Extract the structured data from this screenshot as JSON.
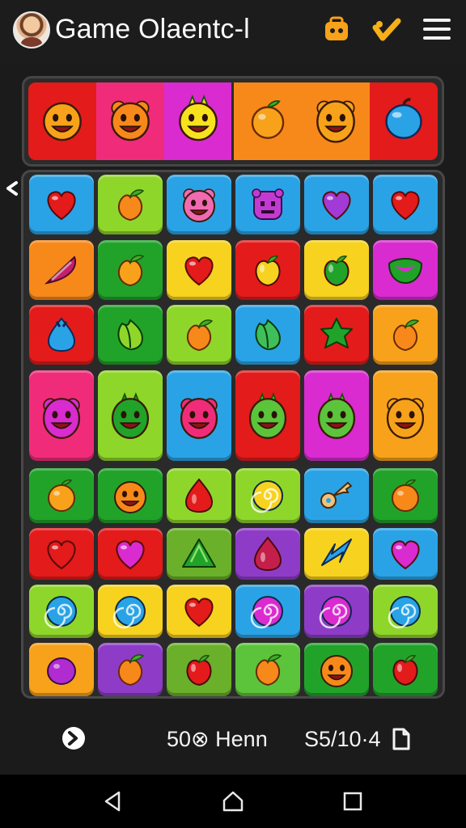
{
  "header": {
    "title": "Game Olaentc-l",
    "icons": [
      "avatar",
      "bag-icon",
      "check-icon",
      "hamburger-menu-icon"
    ]
  },
  "colors": {
    "background": "#1b1b1b",
    "red": "#e31b1b",
    "green": "#21a32a",
    "lime": "#8fd62a",
    "yellow": "#f7d21e",
    "orange": "#f7891a",
    "blue": "#2aa3e6",
    "magenta": "#d92bd0",
    "purple": "#8e3cc8",
    "pink": "#f02c7a"
  },
  "top_strip": [
    {
      "icon": "orange-smiley-icon",
      "color": "#e31b1b"
    },
    {
      "icon": "pink-cat-face-icon",
      "color": "#f02c7a"
    },
    {
      "icon": "yellow-lemon-face-icon",
      "color": "#d92bd0"
    },
    {
      "icon": "orange-fruit-icon",
      "color": "#f7891a"
    },
    {
      "icon": "orange-bear-face-icon",
      "color": "#f7891a"
    },
    {
      "icon": "blue-berry-icon",
      "color": "#e31b1b"
    }
  ],
  "board": {
    "rows": [
      [
        {
          "icon": "heart-icon",
          "fill": "#e31b1b",
          "color": "#2aa3e6"
        },
        {
          "icon": "peach-icon",
          "fill": "#f7891a",
          "color": "#8fd62a"
        },
        {
          "icon": "pig-face-icon",
          "fill": "#f06ab2",
          "color": "#2aa3e6"
        },
        {
          "icon": "monster-face-icon",
          "fill": "#c23bd1",
          "color": "#2aa3e6"
        },
        {
          "icon": "heart-icon",
          "fill": "#a13ad6",
          "color": "#2aa3e6"
        },
        {
          "icon": "heart-icon",
          "fill": "#e31b1b",
          "color": "#2aa3e6"
        }
      ],
      [
        {
          "icon": "candy-wedge-icon",
          "fill": "#c41f6a",
          "color": "#f7891a"
        },
        {
          "icon": "peach-icon",
          "fill": "#f7a21a",
          "color": "#21a32a"
        },
        {
          "icon": "heart-icon",
          "fill": "#e31b1b",
          "color": "#f7d21e"
        },
        {
          "icon": "apple-icon",
          "fill": "#f7d21e",
          "color": "#e31b1b"
        },
        {
          "icon": "apple-icon",
          "fill": "#21a32a",
          "color": "#f7d21e"
        },
        {
          "icon": "smile-mouth-icon",
          "fill": "#21a32a",
          "color": "#d92bd0"
        }
      ],
      [
        {
          "icon": "blue-drop-icon",
          "fill": "#2aa3e6",
          "color": "#e31b1b"
        },
        {
          "icon": "green-leaf-icon",
          "fill": "#8fd62a",
          "color": "#21a32a"
        },
        {
          "icon": "peach-icon",
          "fill": "#f7891a",
          "color": "#8fd62a"
        },
        {
          "icon": "green-leaf-icon",
          "fill": "#3fbf5a",
          "color": "#2aa3e6"
        },
        {
          "icon": "green-star-fruit-icon",
          "fill": "#21a32a",
          "color": "#e31b1b"
        },
        {
          "icon": "peach-icon",
          "fill": "#f7891a",
          "color": "#f7a21a"
        }
      ],
      [
        {
          "icon": "pink-bear-face-icon",
          "fill": "#d92bd0",
          "color": "#f02c7a",
          "tall": true
        },
        {
          "icon": "green-dino-face-icon",
          "fill": "#21a32a",
          "color": "#8fd62a",
          "tall": true
        },
        {
          "icon": "pink-bear-face-icon",
          "fill": "#f02c7a",
          "color": "#2aa3e6",
          "tall": true
        },
        {
          "icon": "green-monster-face-icon",
          "fill": "#5bc43a",
          "color": "#e31b1b",
          "tall": true
        },
        {
          "icon": "green-monster-face-icon",
          "fill": "#5bc43a",
          "color": "#d92bd0",
          "tall": true
        },
        {
          "icon": "orange-bear-face-icon",
          "fill": "#f7a21a",
          "color": "#f7a21a",
          "tall": true
        }
      ],
      [
        {
          "icon": "orange-fruit-icon",
          "fill": "#f7a21a",
          "color": "#21a32a"
        },
        {
          "icon": "orange-smiley-icon",
          "fill": "#f7891a",
          "color": "#21a32a"
        },
        {
          "icon": "red-drop-icon",
          "fill": "#e31b1b",
          "color": "#8fd62a"
        },
        {
          "icon": "swirl-icon",
          "fill": "#f7d21e",
          "color": "#8fd62a"
        },
        {
          "icon": "key-icon",
          "fill": "#f0c27a",
          "color": "#2aa3e6"
        },
        {
          "icon": "orange-fruit-icon",
          "fill": "#f7891a",
          "color": "#21a32a"
        }
      ],
      [
        {
          "icon": "heart-icon",
          "fill": "#e31b1b",
          "color": "#e31b1b"
        },
        {
          "icon": "heart-icon",
          "fill": "#d92bd0",
          "color": "#e31b1b"
        },
        {
          "icon": "green-triangle-icon",
          "fill": "#21a32a",
          "color": "#6ab02a"
        },
        {
          "icon": "red-drop-icon",
          "fill": "#c41f4a",
          "color": "#8e3cc8"
        },
        {
          "icon": "blue-arrow-icon",
          "fill": "#2aa3e6",
          "color": "#f7d21e"
        },
        {
          "icon": "heart-icon",
          "fill": "#d92bd0",
          "color": "#2aa3e6"
        }
      ],
      [
        {
          "icon": "swirl-icon",
          "fill": "#2aa3e6",
          "color": "#8fd62a"
        },
        {
          "icon": "swirl-icon",
          "fill": "#2aa3e6",
          "color": "#f7d21e"
        },
        {
          "icon": "heart-icon",
          "fill": "#e31b1b",
          "color": "#f7d21e"
        },
        {
          "icon": "swirl-icon",
          "fill": "#d92bd0",
          "color": "#2aa3e6"
        },
        {
          "icon": "swirl-icon",
          "fill": "#d92bd0",
          "color": "#8e3cc8"
        },
        {
          "icon": "swirl-icon",
          "fill": "#2aa3e6",
          "color": "#8fd62a"
        }
      ],
      [
        {
          "icon": "plum-icon",
          "fill": "#b02bd0",
          "color": "#f7a21a"
        },
        {
          "icon": "peach-icon",
          "fill": "#f7891a",
          "color": "#8e3cc8"
        },
        {
          "icon": "apple-icon",
          "fill": "#e31b1b",
          "color": "#6ab02a"
        },
        {
          "icon": "peach-icon",
          "fill": "#f7891a",
          "color": "#5bc43a"
        },
        {
          "icon": "orange-smiley-icon",
          "fill": "#f7891a",
          "color": "#21a32a"
        },
        {
          "icon": "apple-icon",
          "fill": "#e31b1b",
          "color": "#21a32a"
        }
      ]
    ]
  },
  "footer": {
    "score_label": "50⊗ Henn",
    "moves_label": "S5/10·4",
    "icons": [
      "next-arrow-icon",
      "copy-icon"
    ]
  },
  "android_nav": {
    "buttons": [
      "back",
      "home",
      "recents"
    ]
  }
}
